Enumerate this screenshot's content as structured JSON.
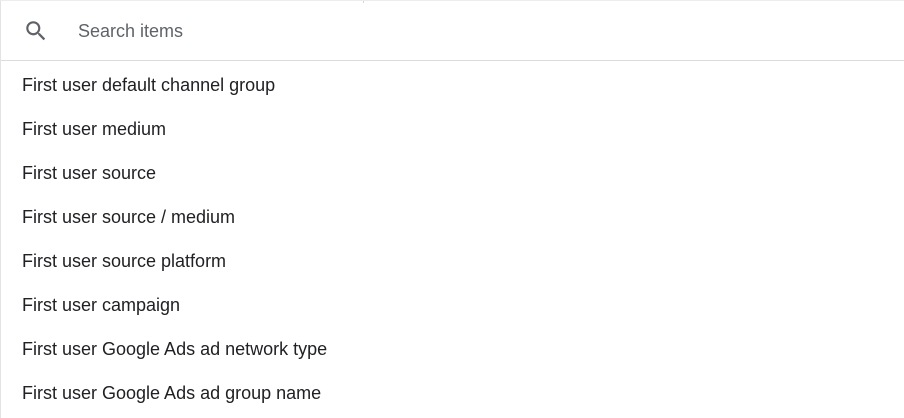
{
  "search": {
    "placeholder": "Search items",
    "value": "",
    "icon": "search-icon"
  },
  "items": [
    {
      "label": "First user default channel group"
    },
    {
      "label": "First user medium"
    },
    {
      "label": "First user source"
    },
    {
      "label": "First user source / medium"
    },
    {
      "label": "First user source platform"
    },
    {
      "label": "First user campaign"
    },
    {
      "label": "First user Google Ads ad network type"
    },
    {
      "label": "First user Google Ads ad group name"
    }
  ]
}
